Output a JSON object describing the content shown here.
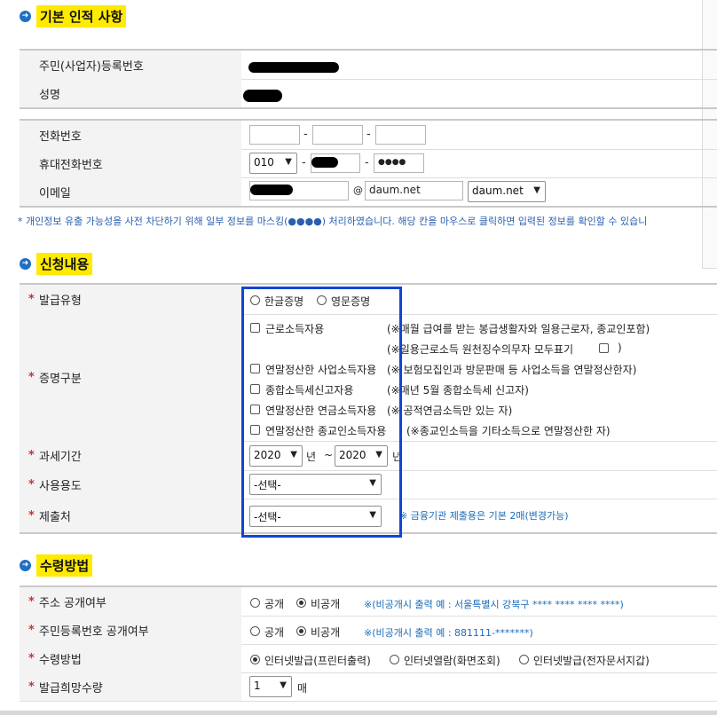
{
  "sections": {
    "basic": {
      "title": "기본 인적 사항"
    },
    "apply": {
      "title": "신청내용"
    },
    "receive": {
      "title": "수령방법"
    }
  },
  "basic": {
    "reg_no_label": "주민(사업자)등록번호",
    "name_label": "성명",
    "phone_label": "전화번호",
    "mobile_label": "휴대전화번호",
    "mobile_prefix": "010",
    "mobile_last": "●●●●",
    "email_label": "이메일",
    "email_at": "@",
    "email_domain": "daum.net",
    "email_domain_select": "daum.net",
    "dash": "-"
  },
  "notice": "* 개인정보 유출 가능성을 사전 차단하기 위해 일부 정보를 마스킹(●●●●) 처리하였습니다. 해당 칸을 마우스로 클릭하면 입력된 정보를 확인할 수 있습니",
  "apply": {
    "issue_type_label": "발급유형",
    "issue_type_options": [
      "한글증명",
      "영문증명"
    ],
    "cert_label": "증명구분",
    "cert_items": [
      {
        "label": "근로소득자용",
        "note": "(※매월 급여를 받는 봉급생활자와 일용근로자, 종교인포함)"
      },
      {
        "label": "",
        "note": "(※일용근로소득 원천징수의무자 모두표기",
        "note_end": ")"
      },
      {
        "label": "연말정산한 사업소득자용",
        "note": "(※ 보험모집인과 방문판매 등 사업소득을 연말정산한자)"
      },
      {
        "label": "종합소득세신고자용",
        "note": "(※매년 5월 종합소득세 신고자)"
      },
      {
        "label": "연말정산한 연금소득자용",
        "note": "(※ 공적연금소득만 있는 자)"
      },
      {
        "label": "연말정산한 종교인소득자용",
        "note": "(※종교인소득을 기타소득으로 연말정산한 자)"
      }
    ],
    "period_label": "과세기간",
    "period_from": "2020",
    "period_to": "2020",
    "year_unit": "년",
    "tilde": "~",
    "usage_label": "사용용도",
    "usage_select": "-선택-",
    "submit_label": "제출처",
    "submit_select": "-선택-",
    "submit_note": "※ 금융기관 제출용은 기본 2매(변경가능)"
  },
  "receive": {
    "addr_label": "주소 공개여부",
    "addr_options": [
      "공개",
      "비공개"
    ],
    "addr_note": "※(비공개시 출력 예 : 서울특별시 강북구 **** **** **** ****)",
    "rrn_label": "주민등록번호 공개여부",
    "rrn_options": [
      "공개",
      "비공개"
    ],
    "rrn_note": "※(비공개시 출력 예 : 881111-*******)",
    "method_label": "수령방법",
    "method_options": [
      "인터넷발급(프린터출력)",
      "인터넷열람(화면조회)",
      "인터넷발급(전자문서지갑)"
    ],
    "count_label": "발급희망수량",
    "count_select": "1",
    "count_unit": "매"
  },
  "required_mark": "*",
  "icons": {
    "section_bullet": "arrow-right-circle-icon",
    "select_chevron": "chevron-down-icon"
  },
  "colors": {
    "highlight": "#ffea00",
    "required": "#d32f2f",
    "note": "#1a6bb8",
    "box": "#1344d6"
  }
}
